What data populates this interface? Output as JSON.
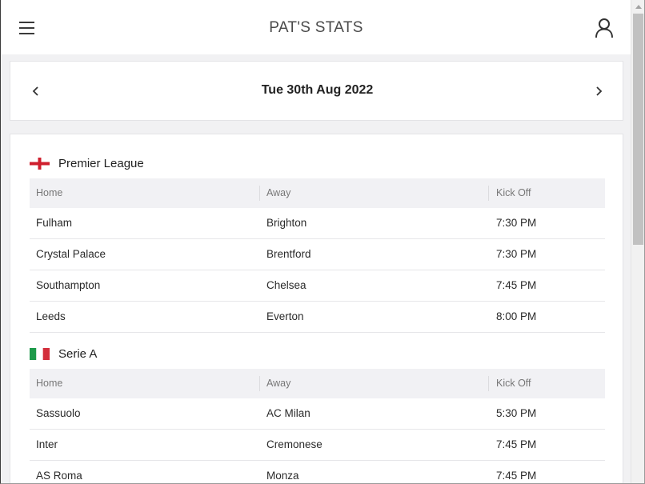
{
  "header": {
    "title": "PAT'S STATS",
    "menu_icon": "hamburger-menu-icon",
    "account_icon": "user-icon"
  },
  "date_nav": {
    "date": "Tue 30th Aug 2022",
    "prev_icon": "chevron-left-icon",
    "next_icon": "chevron-right-icon"
  },
  "leagues": [
    {
      "name": "Premier League",
      "flag": "england-flag-icon",
      "columns": [
        "Home",
        "Away",
        "Kick Off"
      ],
      "matches": [
        {
          "home": "Fulham",
          "away": "Brighton",
          "kickoff": "7:30 PM"
        },
        {
          "home": "Crystal Palace",
          "away": "Brentford",
          "kickoff": "7:30 PM"
        },
        {
          "home": "Southampton",
          "away": "Chelsea",
          "kickoff": "7:45 PM"
        },
        {
          "home": "Leeds",
          "away": "Everton",
          "kickoff": "8:00 PM"
        }
      ]
    },
    {
      "name": "Serie A",
      "flag": "italy-flag-icon",
      "columns": [
        "Home",
        "Away",
        "Kick Off"
      ],
      "matches": [
        {
          "home": "Sassuolo",
          "away": "AC Milan",
          "kickoff": "5:30 PM"
        },
        {
          "home": "Inter",
          "away": "Cremonese",
          "kickoff": "7:45 PM"
        },
        {
          "home": "AS Roma",
          "away": "Monza",
          "kickoff": "7:45 PM"
        }
      ]
    }
  ],
  "colors": {
    "page_background": "#f1f1f3",
    "card_background": "#ffffff",
    "table_header_background": "#f1f1f4",
    "england_red": "#cf1f2e",
    "italy_green": "#1d9a4a",
    "italy_red": "#d32f3c"
  }
}
